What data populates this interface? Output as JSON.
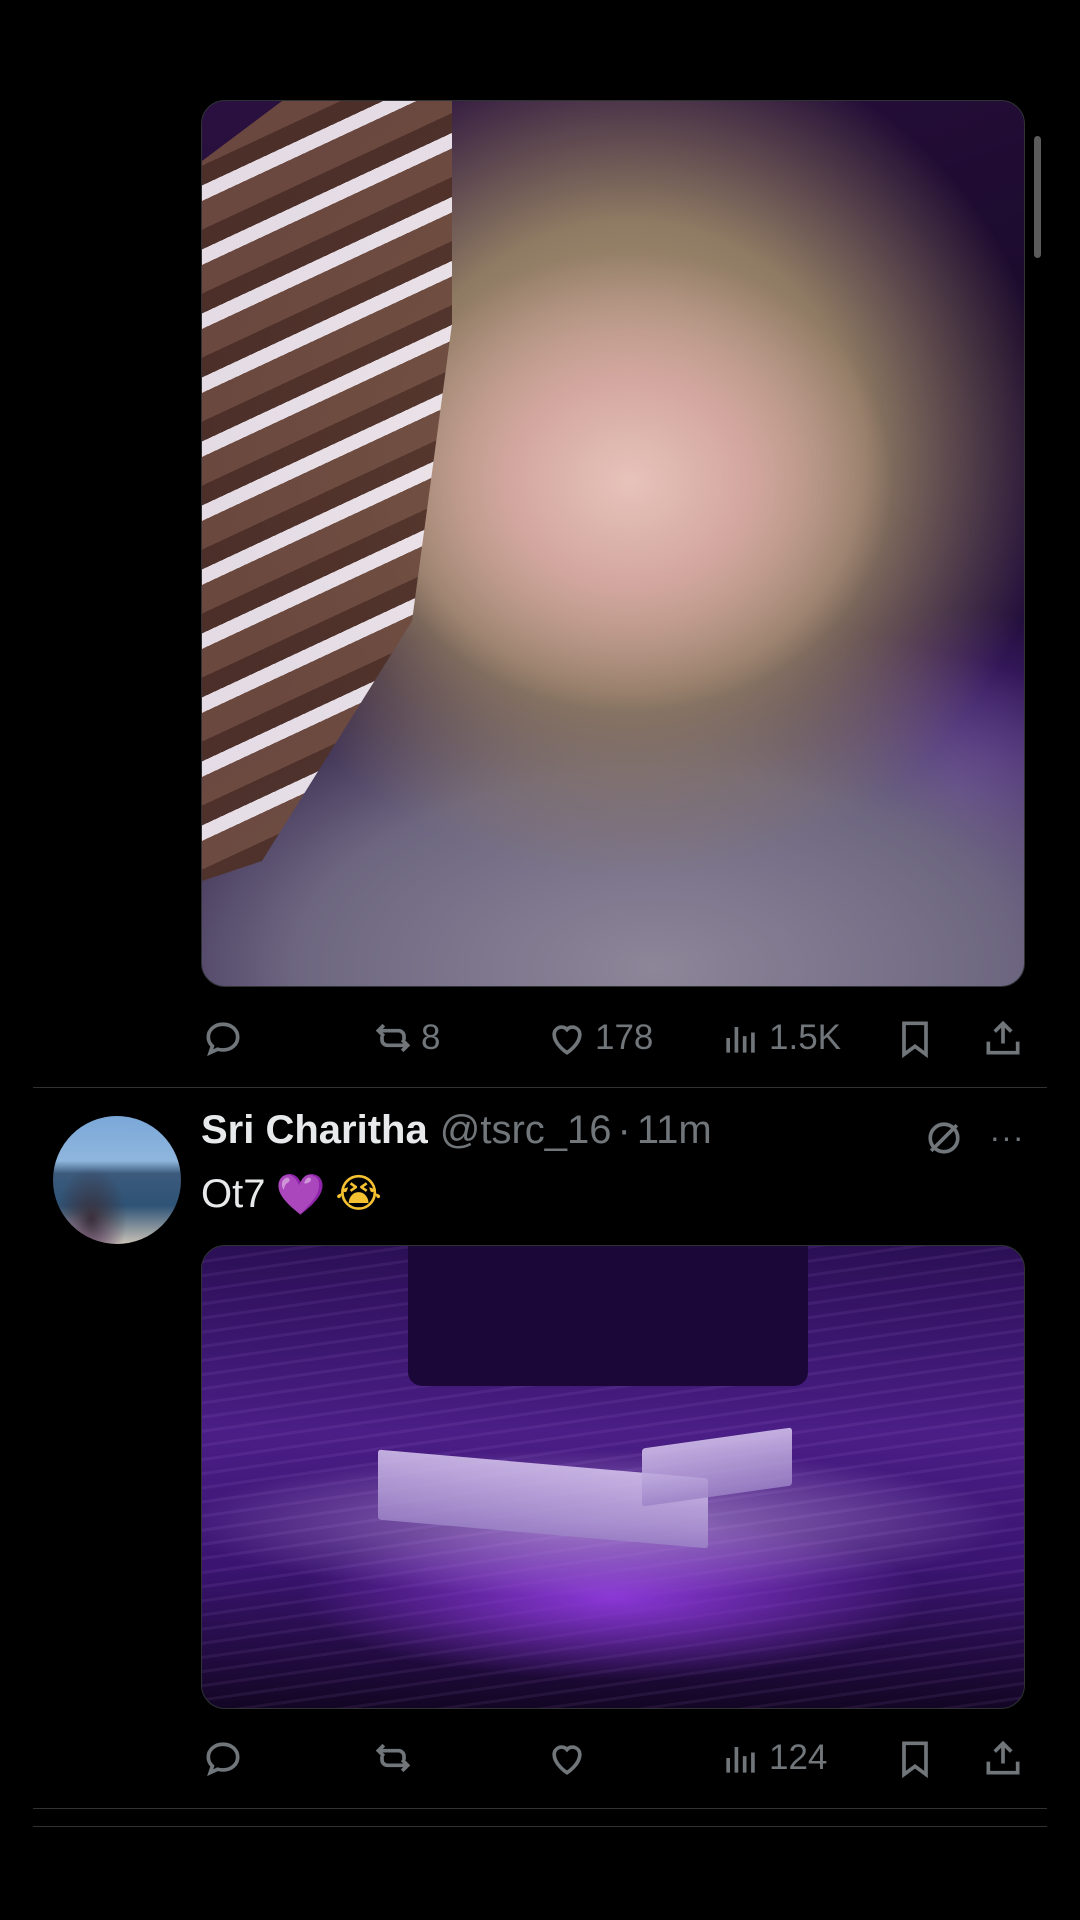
{
  "posts": [
    {
      "media_alt": "Performer with blonde wavy hair in a grey t-shirt raising an arm on stage",
      "actions": {
        "reply_count": "",
        "repost_count": "8",
        "like_count": "178",
        "view_count": "1.5K"
      }
    },
    {
      "author_name": "Sri Charitha",
      "handle": "@tsrc_16",
      "separator": "·",
      "time": "11m",
      "text": "Ot7",
      "emojis": [
        "💜",
        "😭"
      ],
      "media_alt": "Stadium concert with purple lights and large stage screens",
      "more_label": "···",
      "actions": {
        "reply_count": "",
        "repost_count": "",
        "like_count": "",
        "view_count": "124"
      }
    }
  ],
  "colors": {
    "background": "#000000",
    "text_primary": "#e7e9ea",
    "text_secondary": "#71767b",
    "divider": "#2f3336"
  },
  "icons": [
    "reply-icon",
    "repost-icon",
    "like-icon",
    "views-icon",
    "bookmark-icon",
    "share-icon",
    "grok-icon",
    "more-icon"
  ]
}
